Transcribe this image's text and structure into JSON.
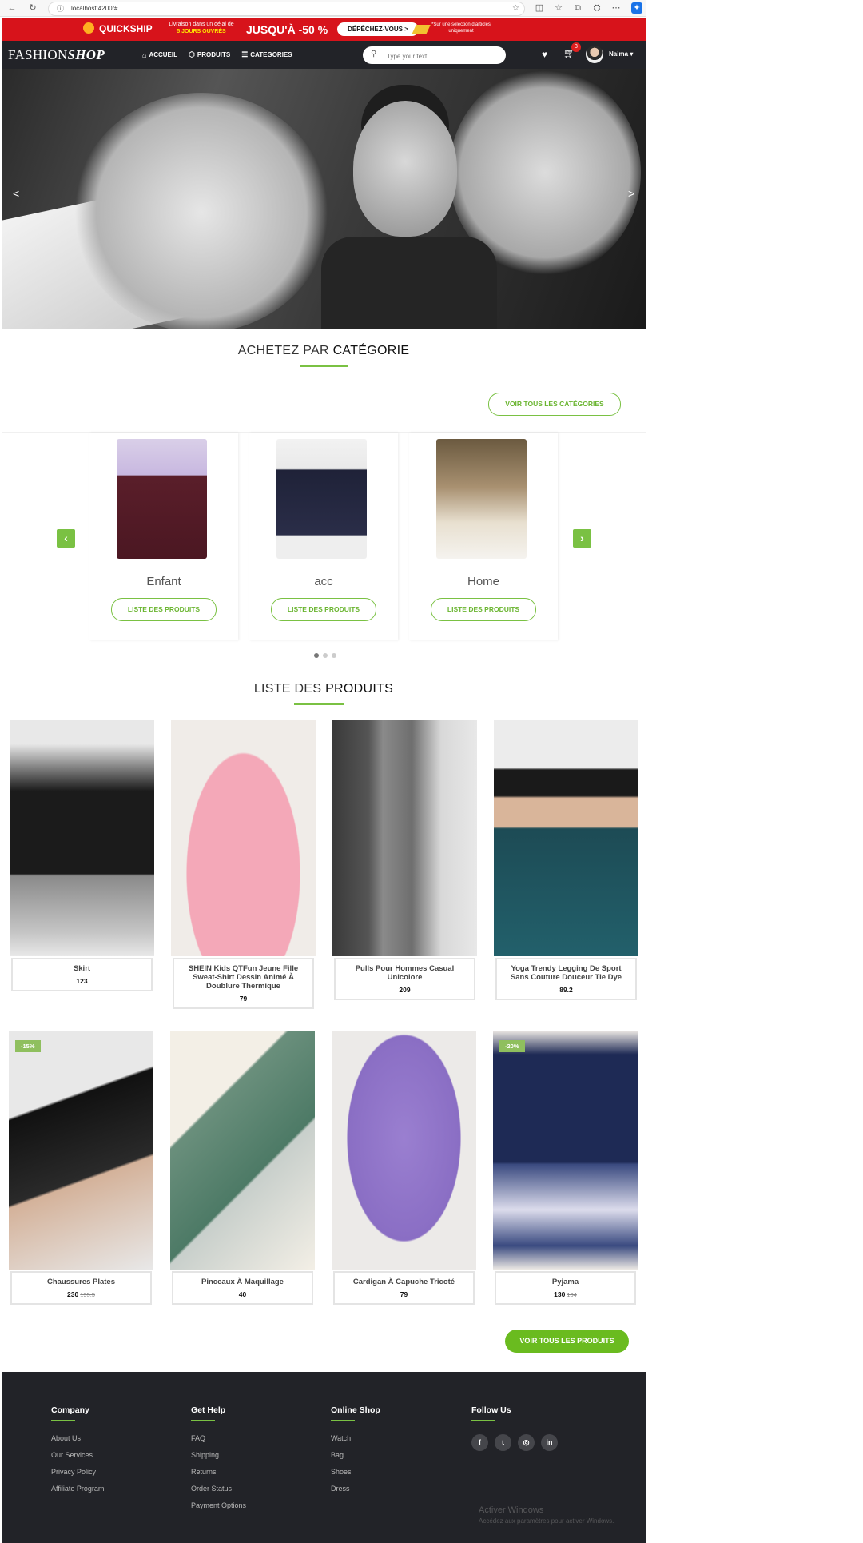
{
  "browser": {
    "url": "localhost:4200/#"
  },
  "promo": {
    "brand": "QUICKSHIP",
    "delivery_line1": "Livraison dans un délai de",
    "delivery_line2": "5 JOURS OUVRÉS",
    "discount": "JUSQU'À -50 %",
    "cta": "DÉPÊCHEZ-VOUS >",
    "note": "*Sur une sélection d'articles uniquement"
  },
  "nav": {
    "logo_light": "FASHION",
    "logo_bold": "SHOP",
    "links": [
      {
        "label": "ACCUEIL",
        "icon": "home-icon"
      },
      {
        "label": "PRODUITS",
        "icon": "box-icon"
      },
      {
        "label": "CATEGORIES",
        "icon": "list-icon"
      }
    ],
    "search_placeholder": "Type your text",
    "cart_count": "3",
    "user_name": "Naima"
  },
  "categories": {
    "title_light": "ACHETEZ PAR ",
    "title_bold": "CATÉGORIE",
    "view_all": "VOIR TOUS LES CATÉGORIES",
    "items": [
      {
        "name": "Enfant",
        "button": "LISTE DES PRODUITS"
      },
      {
        "name": "acc",
        "button": "LISTE DES PRODUITS"
      },
      {
        "name": "Home",
        "button": "LISTE DES PRODUITS"
      }
    ]
  },
  "products": {
    "title_light": "LISTE DES ",
    "title_bold": "PRODUITS",
    "items": [
      {
        "name": "Skirt",
        "price": "123",
        "old_price": "",
        "discount": ""
      },
      {
        "name": "SHEIN Kids QTFun Jeune Fille Sweat-Shirt Dessin Animé À Doublure Thermique",
        "price": "79",
        "old_price": "",
        "discount": ""
      },
      {
        "name": "Pulls Pour Hommes Casual Unicolore",
        "price": "209",
        "old_price": "",
        "discount": ""
      },
      {
        "name": "Yoga Trendy Legging De Sport Sans Couture Douceur Tie Dye",
        "price": "89.2",
        "old_price": "",
        "discount": ""
      },
      {
        "name": "Chaussures Plates",
        "price": "230",
        "old_price": "195.5",
        "discount": "-15%"
      },
      {
        "name": "Pinceaux À Maquillage",
        "price": "40",
        "old_price": "",
        "discount": ""
      },
      {
        "name": "Cardigan À Capuche Tricoté",
        "price": "79",
        "old_price": "",
        "discount": ""
      },
      {
        "name": "Pyjama",
        "price": "130",
        "old_price": "104",
        "discount": "-20%"
      }
    ],
    "view_all": "VOIR TOUS LES PRODUITS"
  },
  "footer": {
    "columns": [
      {
        "title": "Company",
        "links": [
          "About Us",
          "Our Services",
          "Privacy Policy",
          "Affiliate Program"
        ]
      },
      {
        "title": "Get Help",
        "links": [
          "FAQ",
          "Shipping",
          "Returns",
          "Order Status",
          "Payment Options"
        ]
      },
      {
        "title": "Online Shop",
        "links": [
          "Watch",
          "Bag",
          "Shoes",
          "Dress"
        ]
      }
    ],
    "follow_title": "Follow Us",
    "social": [
      "f",
      "t",
      "ig",
      "in"
    ]
  },
  "watermark": {
    "title": "Activer Windows",
    "sub": "Accédez aux paramètres pour activer Windows."
  },
  "colors": {
    "accent": "#7ac143",
    "nav_bg": "#222328",
    "promo_bg": "#d7131b"
  }
}
